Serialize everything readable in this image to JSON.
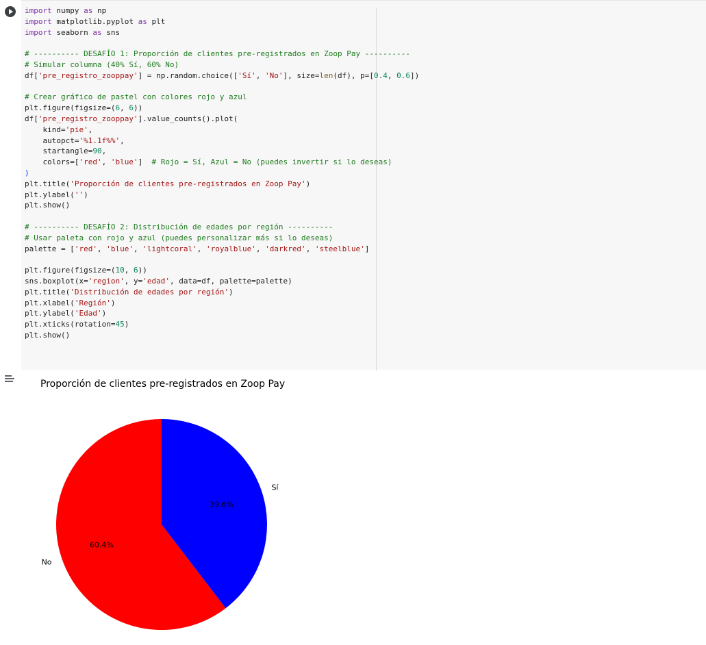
{
  "notebook": {
    "code_lines": [
      [
        {
          "t": "import",
          "c": "kw"
        },
        {
          "t": " numpy "
        },
        {
          "t": "as",
          "c": "kw"
        },
        {
          "t": " np"
        }
      ],
      [
        {
          "t": "import",
          "c": "kw"
        },
        {
          "t": " matplotlib.pyplot "
        },
        {
          "t": "as",
          "c": "kw"
        },
        {
          "t": " plt"
        }
      ],
      [
        {
          "t": "import",
          "c": "kw"
        },
        {
          "t": " seaborn "
        },
        {
          "t": "as",
          "c": "kw"
        },
        {
          "t": " sns"
        }
      ],
      [],
      [
        {
          "t": "# ---------- DESAFÍO 1: Proporción de clientes pre-registrados en Zoop Pay ----------",
          "c": "cm"
        }
      ],
      [
        {
          "t": "# Simular columna (40% Sí, 60% No)",
          "c": "cm"
        }
      ],
      [
        {
          "t": "df["
        },
        {
          "t": "'pre_registro_zooppay'",
          "c": "st"
        },
        {
          "t": "] = np.random.choice(["
        },
        {
          "t": "'Sí'",
          "c": "st"
        },
        {
          "t": ", "
        },
        {
          "t": "'No'",
          "c": "st"
        },
        {
          "t": "], size="
        },
        {
          "t": "len",
          "c": "bi"
        },
        {
          "t": "(df), p=["
        },
        {
          "t": "0.4",
          "c": "nm"
        },
        {
          "t": ", "
        },
        {
          "t": "0.6",
          "c": "nm"
        },
        {
          "t": "])"
        }
      ],
      [],
      [
        {
          "t": "# Crear gráfico de pastel con colores rojo y azul",
          "c": "cm"
        }
      ],
      [
        {
          "t": "plt.figure(figsize=("
        },
        {
          "t": "6",
          "c": "nm"
        },
        {
          "t": ", "
        },
        {
          "t": "6",
          "c": "nm"
        },
        {
          "t": "))"
        }
      ],
      [
        {
          "t": "df["
        },
        {
          "t": "'pre_registro_zooppay'",
          "c": "st"
        },
        {
          "t": "].value_counts().plot("
        }
      ],
      [
        {
          "t": "    kind="
        },
        {
          "t": "'pie'",
          "c": "st"
        },
        {
          "t": ","
        }
      ],
      [
        {
          "t": "    autopct="
        },
        {
          "t": "'%1.1f%%'",
          "c": "st"
        },
        {
          "t": ","
        }
      ],
      [
        {
          "t": "    startangle="
        },
        {
          "t": "90",
          "c": "nm"
        },
        {
          "t": ","
        }
      ],
      [
        {
          "t": "    colors=["
        },
        {
          "t": "'red'",
          "c": "st"
        },
        {
          "t": ", "
        },
        {
          "t": "'blue'",
          "c": "st"
        },
        {
          "t": "]  "
        },
        {
          "t": "# Rojo = Sí, Azul = No (puedes invertir si lo deseas)",
          "c": "cm"
        }
      ],
      [
        {
          "t": ")",
          "c": "pr"
        }
      ],
      [
        {
          "t": "plt.title("
        },
        {
          "t": "'Proporción de clientes pre-registrados en Zoop Pay'",
          "c": "st"
        },
        {
          "t": ")"
        }
      ],
      [
        {
          "t": "plt.ylabel("
        },
        {
          "t": "''",
          "c": "st"
        },
        {
          "t": ")"
        }
      ],
      [
        {
          "t": "plt.show()"
        }
      ],
      [],
      [
        {
          "t": "# ---------- DESAFÍO 2: Distribución de edades por región ----------",
          "c": "cm"
        }
      ],
      [
        {
          "t": "# Usar paleta con rojo y azul (puedes personalizar más si lo deseas)",
          "c": "cm"
        }
      ],
      [
        {
          "t": "palette = ["
        },
        {
          "t": "'red'",
          "c": "st"
        },
        {
          "t": ", "
        },
        {
          "t": "'blue'",
          "c": "st"
        },
        {
          "t": ", "
        },
        {
          "t": "'lightcoral'",
          "c": "st"
        },
        {
          "t": ", "
        },
        {
          "t": "'royalblue'",
          "c": "st"
        },
        {
          "t": ", "
        },
        {
          "t": "'darkred'",
          "c": "st"
        },
        {
          "t": ", "
        },
        {
          "t": "'steelblue'",
          "c": "st"
        },
        {
          "t": "]"
        }
      ],
      [],
      [
        {
          "t": "plt.figure(figsize=("
        },
        {
          "t": "10",
          "c": "nm"
        },
        {
          "t": ", "
        },
        {
          "t": "6",
          "c": "nm"
        },
        {
          "t": "))"
        }
      ],
      [
        {
          "t": "sns.boxplot(x="
        },
        {
          "t": "'region'",
          "c": "st"
        },
        {
          "t": ", y="
        },
        {
          "t": "'edad'",
          "c": "st"
        },
        {
          "t": ", data=df, palette=palette)"
        }
      ],
      [
        {
          "t": "plt.title("
        },
        {
          "t": "'Distribución de edades por región'",
          "c": "st"
        },
        {
          "t": ")"
        }
      ],
      [
        {
          "t": "plt.xlabel("
        },
        {
          "t": "'Región'",
          "c": "st"
        },
        {
          "t": ")"
        }
      ],
      [
        {
          "t": "plt.ylabel("
        },
        {
          "t": "'Edad'",
          "c": "st"
        },
        {
          "t": ")"
        }
      ],
      [
        {
          "t": "plt.xticks(rotation="
        },
        {
          "t": "45",
          "c": "nm"
        },
        {
          "t": ")"
        }
      ],
      [
        {
          "t": "plt.show()"
        }
      ]
    ]
  },
  "output": {
    "icon": "output-settings-icon"
  },
  "chart_data": {
    "type": "pie",
    "title": "Proporción de clientes pre-registrados en Zoop Pay",
    "startangle": 90,
    "slices": [
      {
        "label": "Sí",
        "value": 39.6,
        "pct_label": "39.6%",
        "color": "#0000ff"
      },
      {
        "label": "No",
        "value": 60.4,
        "pct_label": "60.4%",
        "color": "#ff0000"
      }
    ]
  }
}
